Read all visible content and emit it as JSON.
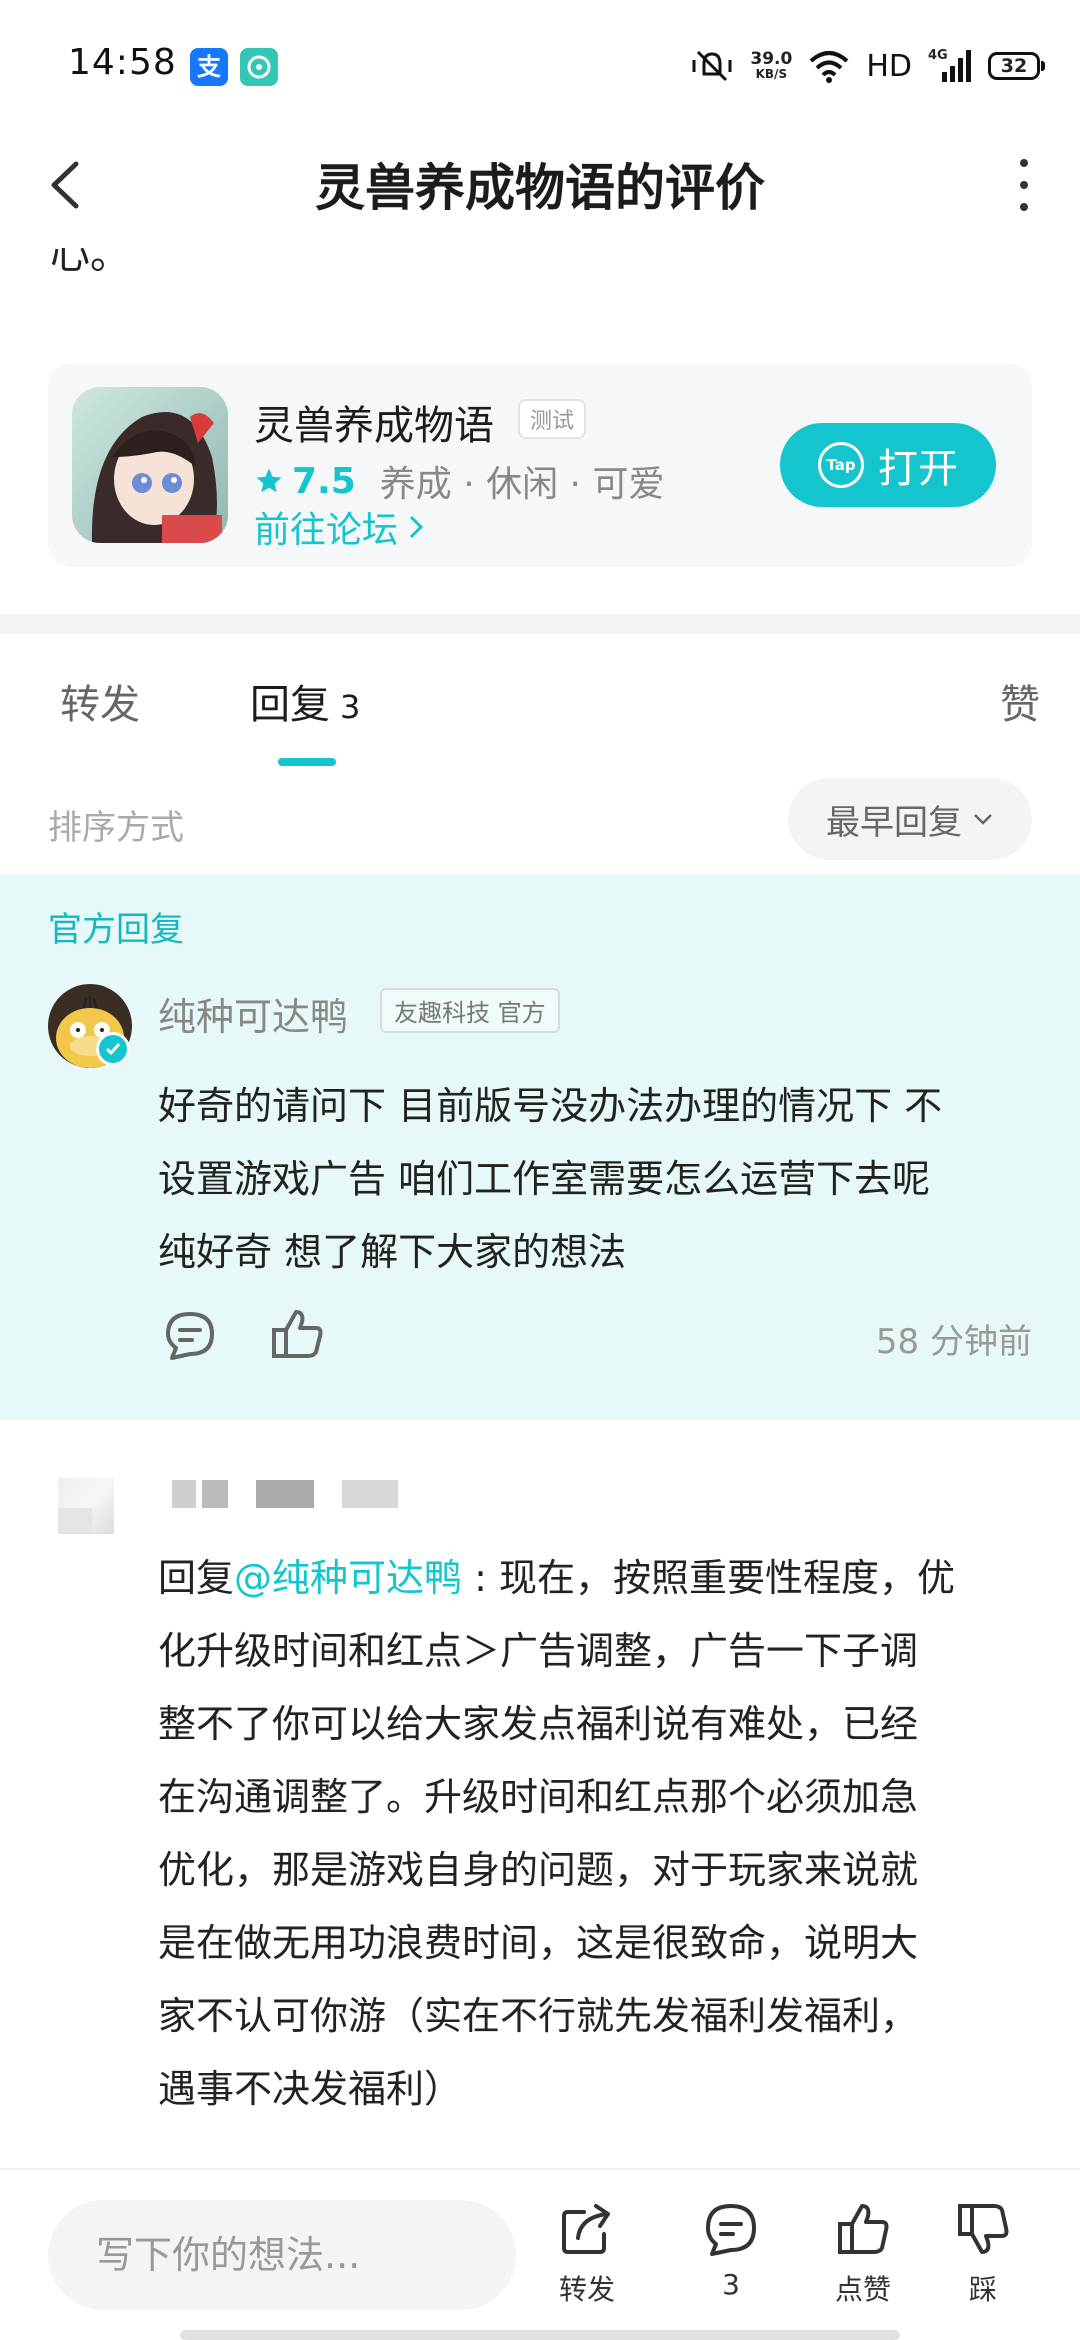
{
  "status_bar": {
    "time": "14:58",
    "app_icon_1": "支",
    "network_speed_value": "39.0",
    "network_speed_unit": "KB/S",
    "hd": "HD",
    "network_type": "4G",
    "battery": "32",
    "colors": {
      "alipay": "#1677ff",
      "chat": "#33c6b4"
    }
  },
  "header": {
    "title": "灵兽养成物语的评价"
  },
  "cut_text": "心。",
  "game_card": {
    "name": "灵兽养成物语",
    "tag": "测试",
    "rating": "7.5",
    "genres": "养成 · 休闲 · 可爱",
    "forum_link": "前往论坛",
    "open_button": "打开",
    "tap_logo": "Tap"
  },
  "tabs": [
    {
      "label": "转发",
      "count": ""
    },
    {
      "label": "回复",
      "count": "3"
    },
    {
      "label": "赞",
      "count": ""
    }
  ],
  "sort": {
    "label": "排序方式",
    "value": "最早回复"
  },
  "official_reply": {
    "section_label": "官方回复",
    "username": "纯种可达鸭",
    "tag": "友趣科技 官方",
    "body_lines": [
      "好奇的请问下 目前版号没办法办理的情况下 不",
      "设置游戏广告 咱们工作室需要怎么运营下去呢",
      "纯好奇 想了解下大家的想法"
    ],
    "time": "58 分钟前"
  },
  "comment": {
    "reply_prefix": "回复",
    "mention": "@纯种可达鸭",
    "body_first": " : 现在，按照重要性程度，优",
    "body_lines": [
      "化升级时间和红点＞广告调整，广告一下子调",
      "整不了你可以给大家发点福利说有难处，已经",
      "在沟通调整了。升级时间和红点那个必须加急",
      "优化，那是游戏自身的问题，对于玩家来说就",
      "是在做无用功浪费时间，这是很致命，说明大",
      "家不认可你游（实在不行就先发福利发福利，",
      "遇事不决发福利）"
    ]
  },
  "bottom_bar": {
    "input_placeholder": "写下你的想法...",
    "repost": "转发",
    "reply_count": "3",
    "like": "点赞",
    "dislike": "踩"
  },
  "colors": {
    "accent": "#15c5ce",
    "official_bg": "#e6f8f8"
  },
  "icons": [
    "back-icon",
    "more-icon",
    "star-icon",
    "chevron-right-icon",
    "tap-icon",
    "chevron-down-icon",
    "verified-icon",
    "comment-icon",
    "thumbs-up-icon",
    "share-icon",
    "thumbs-down-icon"
  ]
}
